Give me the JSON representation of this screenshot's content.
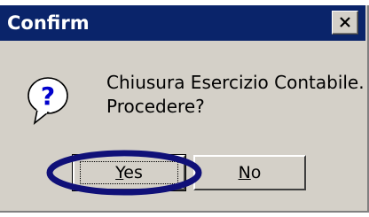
{
  "window": {
    "title": "Confirm",
    "close_glyph": "✕"
  },
  "icon": {
    "name": "question-icon",
    "glyph": "?"
  },
  "message": {
    "line1": "Chiusura Esercizio Contabile.",
    "line2": "Procedere?"
  },
  "buttons": {
    "yes_label": "Yes",
    "no_label": "No"
  },
  "colors": {
    "titlebar": "#0a246a",
    "dialog_bg": "#d4d0c8",
    "highlight": "#101078"
  }
}
